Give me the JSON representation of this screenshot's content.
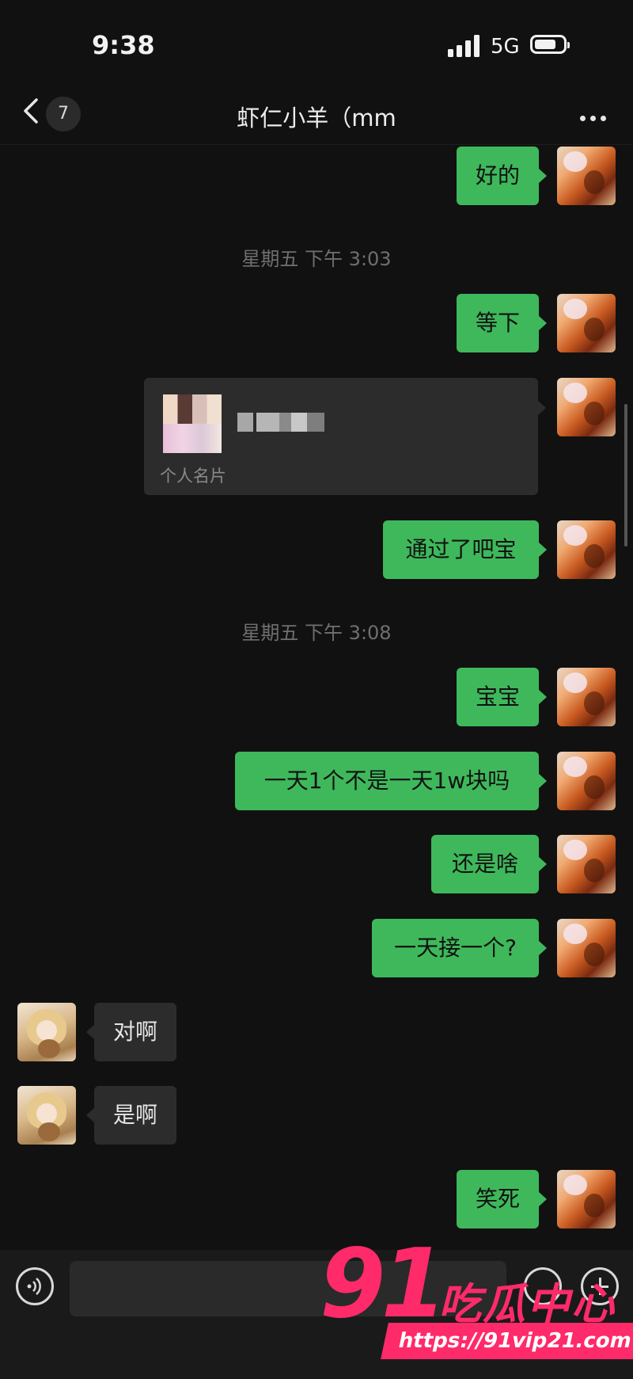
{
  "status_bar": {
    "time": "9:38",
    "network": "5G"
  },
  "header": {
    "badge_count": "7",
    "title": "虾仁小羊（mm"
  },
  "messages": [
    {
      "type": "text",
      "from": "me",
      "text": "好的"
    },
    {
      "type": "timestamp",
      "text": "星期五 下午 3:03"
    },
    {
      "type": "text",
      "from": "me",
      "text": "等下"
    },
    {
      "type": "card",
      "from": "me",
      "label": "个人名片"
    },
    {
      "type": "text",
      "from": "me",
      "text": "通过了吧宝"
    },
    {
      "type": "timestamp",
      "text": "星期五 下午 3:08"
    },
    {
      "type": "text",
      "from": "me",
      "text": "宝宝"
    },
    {
      "type": "text",
      "from": "me",
      "text": "一天1个不是一天1w块吗"
    },
    {
      "type": "text",
      "from": "me",
      "text": "还是啥"
    },
    {
      "type": "text",
      "from": "me",
      "text": "一天接一个?"
    },
    {
      "type": "text",
      "from": "her",
      "text": "对啊"
    },
    {
      "type": "text",
      "from": "her",
      "text": "是啊"
    },
    {
      "type": "text",
      "from": "me",
      "text": "笑死"
    }
  ],
  "watermark": {
    "number": "91",
    "brand": "吃瓜中心",
    "url": "https://91vip21.com"
  },
  "icons": {
    "back": "chevron-left-icon",
    "more": "more-dots-icon",
    "voice": "voice-icon",
    "emoji": "emoji-icon",
    "plus": "plus-icon"
  }
}
